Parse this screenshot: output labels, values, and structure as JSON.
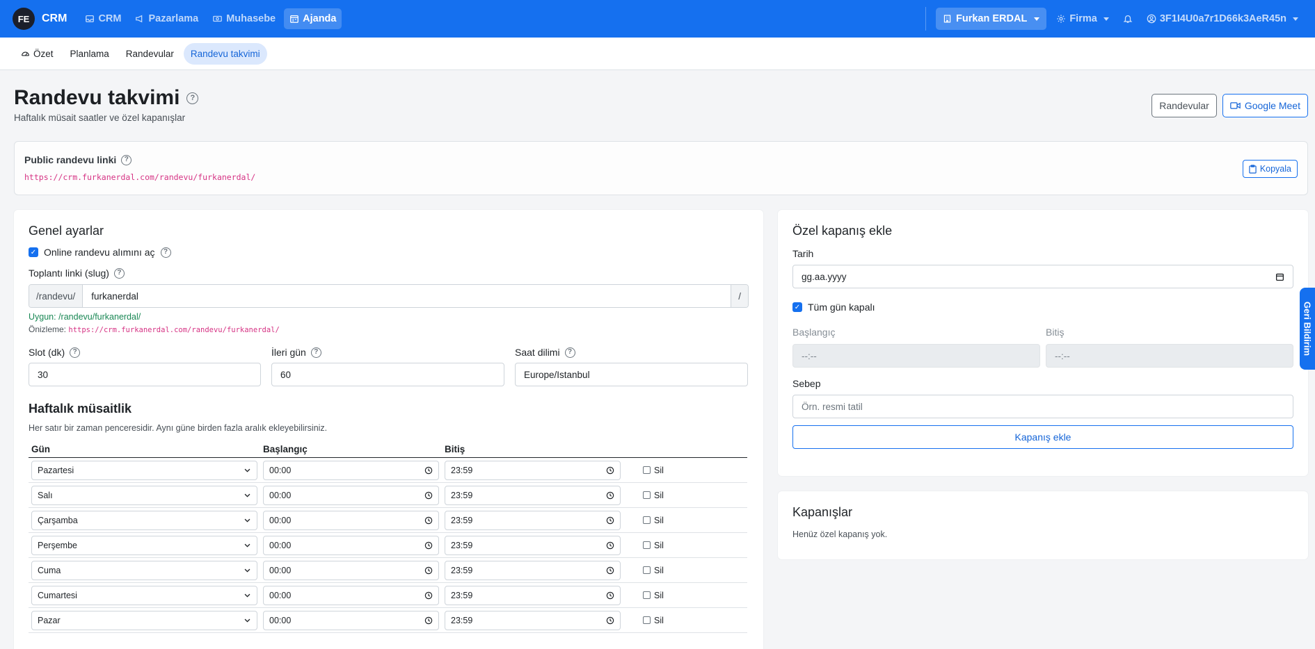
{
  "topbar": {
    "brand_logo": "FE",
    "brand_name": "CRM",
    "nav": [
      {
        "label": "CRM",
        "icon": "inbox-icon"
      },
      {
        "label": "Pazarlama",
        "icon": "megaphone-icon"
      },
      {
        "label": "Muhasebe",
        "icon": "cash-icon"
      },
      {
        "label": "Ajanda",
        "icon": "calendar-icon",
        "active": true
      }
    ],
    "company": "Furkan ERDAL",
    "firma": "Firma",
    "user": "3F1I4U0a7r1D66k3AeR45n"
  },
  "subnav": [
    {
      "label": "Özet",
      "icon": "speedometer-icon"
    },
    {
      "label": "Planlama"
    },
    {
      "label": "Randevular"
    },
    {
      "label": "Randevu takvimi",
      "active": true
    }
  ],
  "page": {
    "title": "Randevu takvimi",
    "subtitle": "Haftalık müsait saatler ve özel kapanışlar",
    "btn_randevular": "Randevular",
    "btn_meet": "Google Meet",
    "help": "?"
  },
  "public_link": {
    "label": "Public randevu linki",
    "url": "https://crm.furkanerdal.com/randevu/furkanerdal/",
    "copy": "Kopyala"
  },
  "general": {
    "title": "Genel ayarlar",
    "online_label": "Online randevu alımını aç",
    "slug_label": "Toplantı linki (slug)",
    "slug_prefix": "/randevu/",
    "slug_value": "furkanerdal",
    "slug_suffix": "/",
    "slug_ok": "Uygun: /randevu/furkanerdal/",
    "preview_label": "Önizleme:",
    "preview_url": "https://crm.furkanerdal.com/randevu/furkanerdal/",
    "slot_label": "Slot (dk)",
    "slot_value": "30",
    "ahead_label": "İleri gün",
    "ahead_value": "60",
    "tz_label": "Saat dilimi",
    "tz_value": "Europe/Istanbul"
  },
  "weekly": {
    "title": "Haftalık müsaitlik",
    "desc": "Her satır bir zaman penceresidir. Aynı güne birden fazla aralık ekleyebilirsiniz.",
    "col_day": "Gün",
    "col_start": "Başlangıç",
    "col_end": "Bitiş",
    "delete_label": "Sil",
    "rows": [
      {
        "day": "Pazartesi",
        "start": "00:00",
        "end": "23:59"
      },
      {
        "day": "Salı",
        "start": "00:00",
        "end": "23:59"
      },
      {
        "day": "Çarşamba",
        "start": "00:00",
        "end": "23:59"
      },
      {
        "day": "Perşembe",
        "start": "00:00",
        "end": "23:59"
      },
      {
        "day": "Cuma",
        "start": "00:00",
        "end": "23:59"
      },
      {
        "day": "Cumartesi",
        "start": "00:00",
        "end": "23:59"
      },
      {
        "day": "Pazar",
        "start": "00:00",
        "end": "23:59"
      }
    ]
  },
  "closure_form": {
    "title": "Özel kapanış ekle",
    "date_label": "Tarih",
    "date_placeholder": "gg.aa.yyyy",
    "allday_label": "Tüm gün kapalı",
    "start_label": "Başlangıç",
    "start_value": "--:--",
    "end_label": "Bitiş",
    "end_value": "--:--",
    "reason_label": "Sebep",
    "reason_placeholder": "Örn. resmi tatil",
    "submit": "Kapanış ekle"
  },
  "closures": {
    "title": "Kapanışlar",
    "empty": "Henüz özel kapanış yok."
  },
  "feedback_tab": "Geri Bildirim"
}
